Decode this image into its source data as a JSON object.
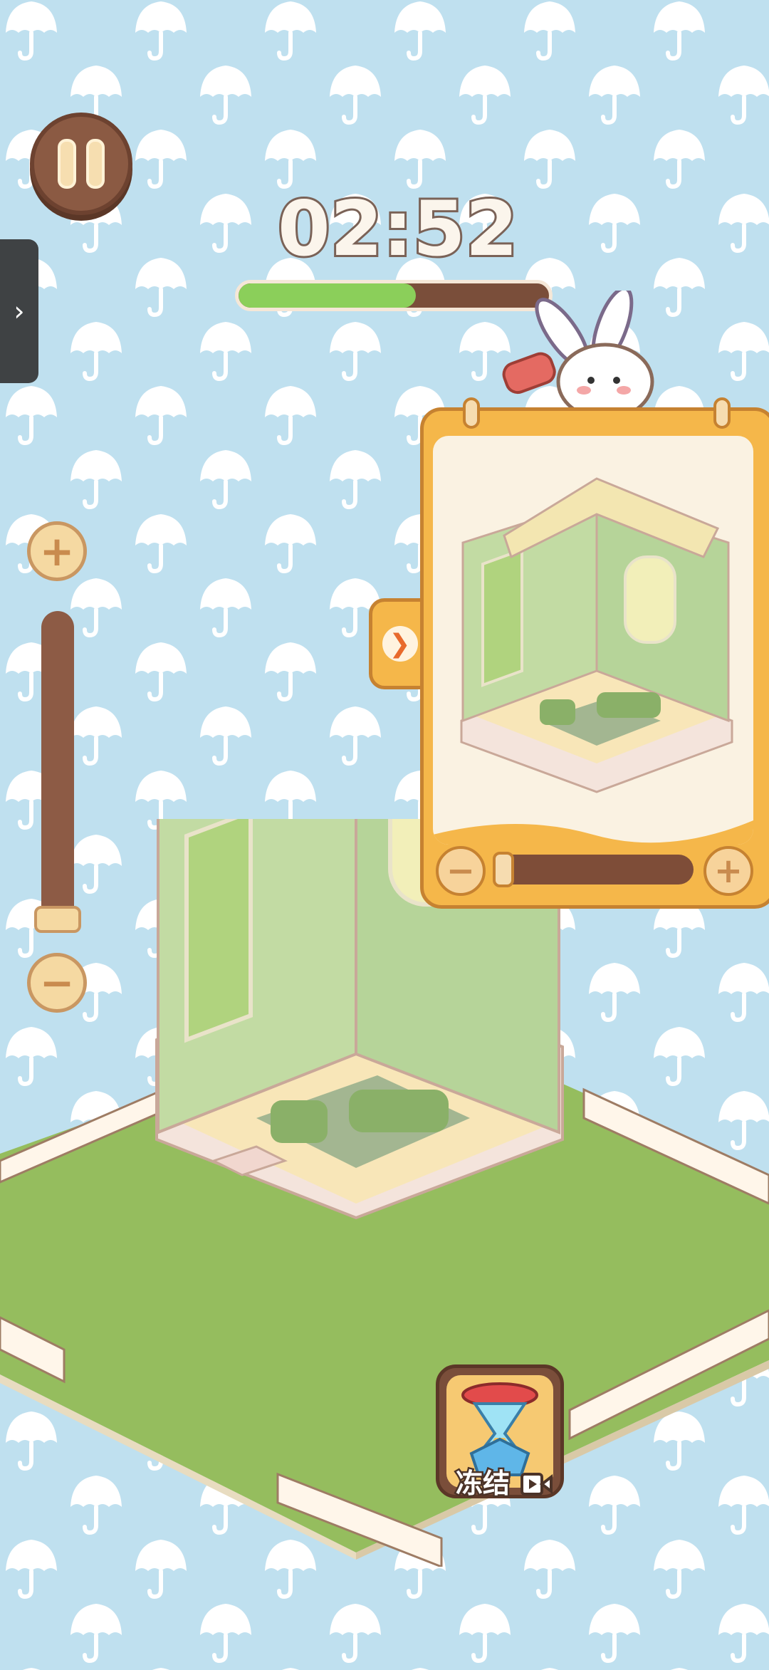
{
  "hud": {
    "timer": "02:52",
    "time_remaining_fraction": 0.57,
    "pause_icon": "pause-icon",
    "side_handle_icon": "chevron-right-icon"
  },
  "zoom": {
    "plus_symbol": "+",
    "minus_symbol": "−",
    "level_fraction": 0.0
  },
  "reference_panel": {
    "toggle_icon": "collapse-arrow-icon",
    "minus_symbol": "−",
    "plus_symbol": "+",
    "zoom_fraction": 0.0
  },
  "powerup": {
    "label": "冻结",
    "icon": "hourglass-icon",
    "video_icon": "video-ad-icon"
  },
  "colors": {
    "background": "#bfe0ef",
    "progress_fill": "#8bcf5a",
    "panel": "#f5b74a",
    "brown": "#7a4e3a"
  }
}
